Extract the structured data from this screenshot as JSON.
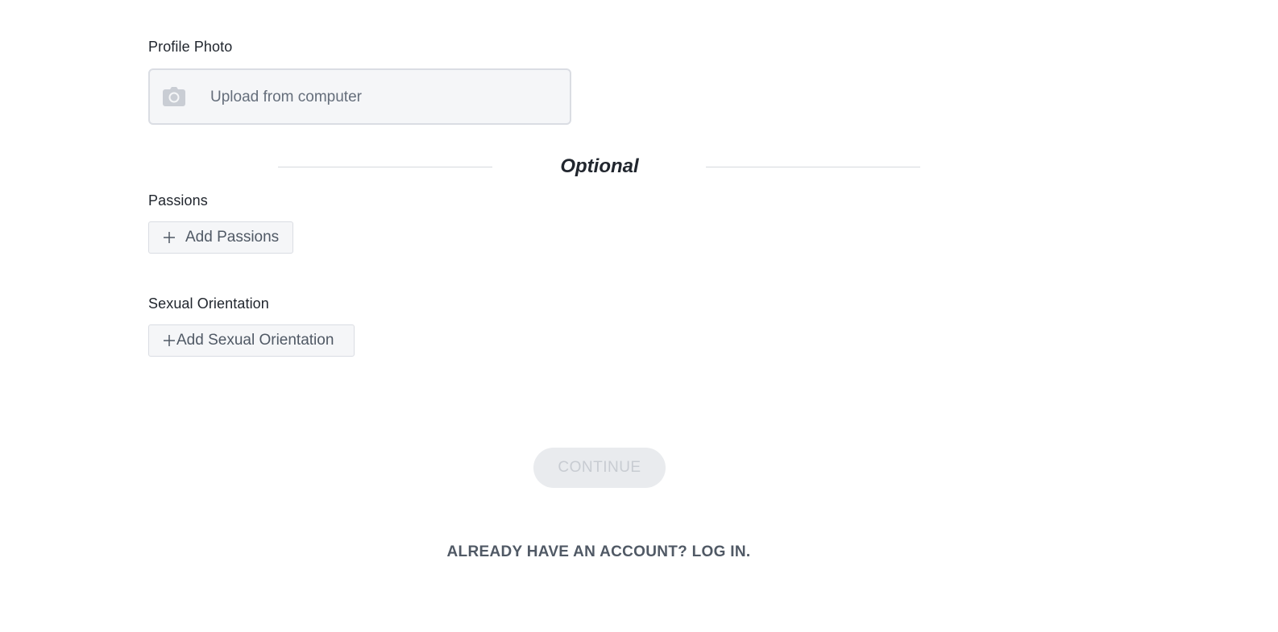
{
  "profile_photo": {
    "label": "Profile Photo",
    "upload_text": "Upload from computer",
    "icon": "camera-icon"
  },
  "optional_section": {
    "title": "Optional"
  },
  "passions": {
    "label": "Passions",
    "button_label": "Add Passions",
    "icon": "plus-icon"
  },
  "sexual_orientation": {
    "label": "Sexual Orientation",
    "button_label": "Add Sexual Orientation",
    "icon": "plus-icon"
  },
  "continue_button": {
    "label": "CONTINUE",
    "state": "disabled"
  },
  "login_link": {
    "label": "ALREADY HAVE AN ACCOUNT? LOG IN."
  },
  "colors": {
    "text": "#21262e",
    "muted_text": "#505965",
    "field_background": "#f5f6f8",
    "border": "#dadde3",
    "disabled_button_background": "#e9ebee",
    "disabled_button_text": "#c8ccd2"
  }
}
